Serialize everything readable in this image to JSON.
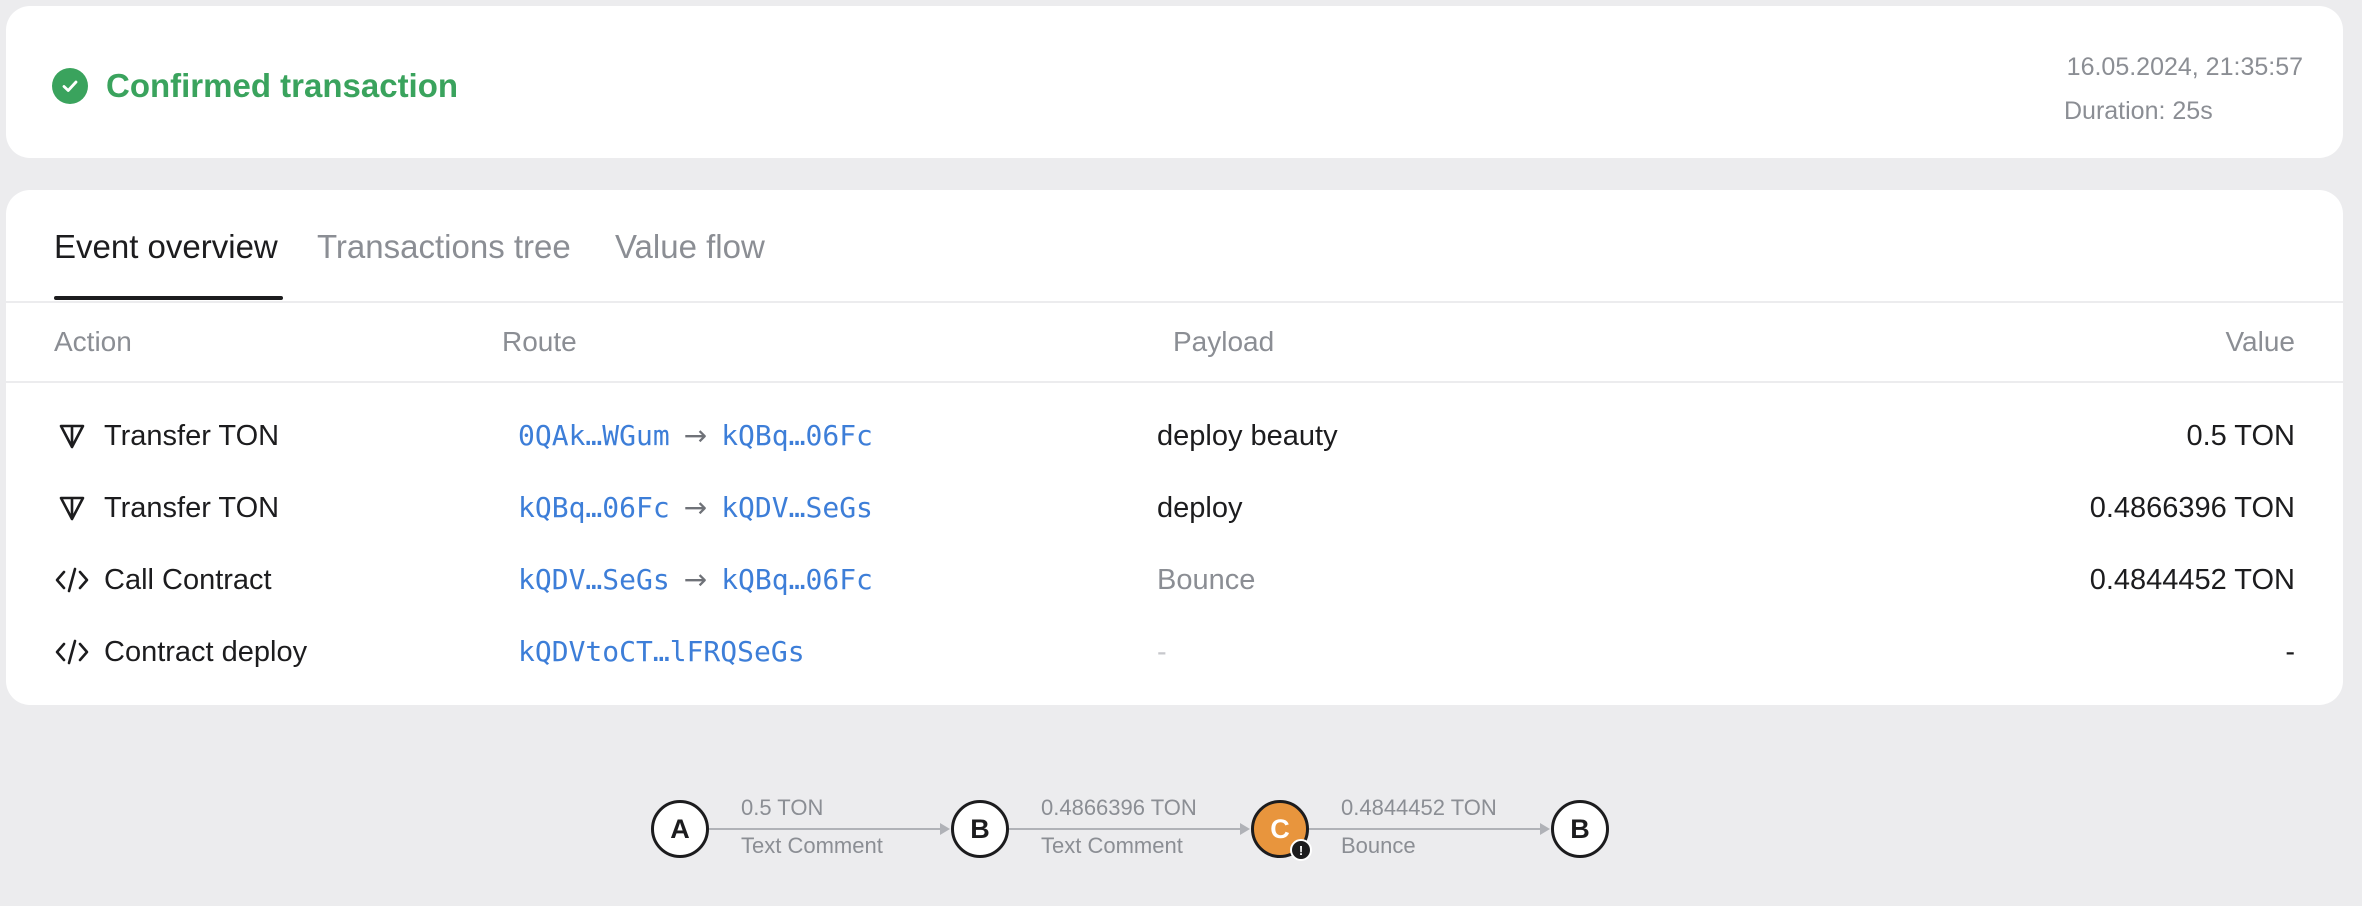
{
  "status": {
    "title": "Confirmed transaction",
    "datetime": "16.05.2024, 21:35:57",
    "duration": "Duration: 25s",
    "color": "#3aa35d"
  },
  "tabs": [
    {
      "label": "Event overview",
      "active": true
    },
    {
      "label": "Transactions tree",
      "active": false
    },
    {
      "label": "Value flow",
      "active": false
    }
  ],
  "table": {
    "headers": {
      "action": "Action",
      "route": "Route",
      "payload": "Payload",
      "value": "Value"
    },
    "rows": [
      {
        "icon": "ton-icon",
        "action": "Transfer TON",
        "from": "0QAk…WGum",
        "to": "kQBq…06Fc",
        "payload": "deploy beauty",
        "value": "0.5 TON"
      },
      {
        "icon": "ton-icon",
        "action": "Transfer TON",
        "from": "kQBq…06Fc",
        "to": "kQDV…SeGs",
        "payload": "deploy",
        "value": "0.4866396 TON"
      },
      {
        "icon": "code-icon",
        "action": "Call Contract",
        "from": "kQDV…SeGs",
        "to": "kQBq…06Fc",
        "payload": "Bounce",
        "value": "0.4844452 TON"
      },
      {
        "icon": "code-icon",
        "action": "Contract deploy",
        "from": "kQDVtoCT…lFRQSeGs",
        "to": "",
        "payload": "-",
        "value": "-"
      }
    ]
  },
  "flow": {
    "nodes": [
      {
        "label": "A",
        "style": "default"
      },
      {
        "label": "B",
        "style": "default"
      },
      {
        "label": "C",
        "style": "orange",
        "badge": "!"
      },
      {
        "label": "B",
        "style": "default"
      }
    ],
    "edges": [
      {
        "value": "0.5 TON",
        "type": "Text Comment"
      },
      {
        "value": "0.4866396 TON",
        "type": "Text Comment"
      },
      {
        "value": "0.4844452 TON",
        "type": "Bounce"
      }
    ]
  },
  "arrow_glyph": "→",
  "colors": {
    "link": "#3d7ed8",
    "muted": "#8b8e94",
    "bounce_node": "#e8953d",
    "background": "#ececee"
  }
}
